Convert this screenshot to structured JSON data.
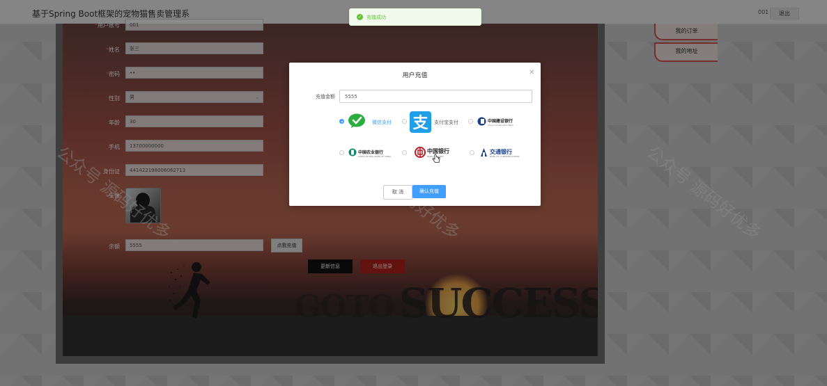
{
  "header": {
    "title": "基于Spring Boot框架的宠物猫售卖管理系",
    "username": "001",
    "logout_label": "退出"
  },
  "toast": {
    "message": "充值成功",
    "icon": "check-circle-icon",
    "color": "#67c23a"
  },
  "form": {
    "fields": [
      {
        "label": "用户账号",
        "value": "001"
      },
      {
        "label": "姓名",
        "value": "张三"
      },
      {
        "label": "密码",
        "value": "••"
      },
      {
        "label": "性别",
        "value": "男"
      },
      {
        "label": "年龄",
        "value": "30"
      },
      {
        "label": "手机",
        "value": "13700000000"
      },
      {
        "label": "身份证",
        "value": "441422198006062713"
      }
    ],
    "avatar_label": "头像",
    "balance_label": "余额",
    "balance_value": "5555",
    "recharge_label": "点我充值",
    "update_label": "更新信息",
    "logout_label": "退出登录"
  },
  "sidebar": {
    "items": [
      {
        "label": "我的订单"
      },
      {
        "label": "我的地址"
      }
    ]
  },
  "banner": {
    "goto": "GOTO",
    "success": "SUCCESS"
  },
  "watermark": {
    "text": "公众号 源码好优多"
  },
  "dialog": {
    "title": "用户充值",
    "amount_label": "充值金额",
    "amount_value": "5555",
    "payment_methods": [
      {
        "label": "微信支付",
        "selected": true,
        "icon": "wechat-icon"
      },
      {
        "label": "支付宝支付",
        "selected": false,
        "icon": "alipay-icon"
      },
      {
        "label": "中国建设银行",
        "sub": "China Construction Bank",
        "selected": false,
        "icon": "ccb-logo"
      },
      {
        "label": "中国农业银行",
        "sub": "AGRICULTURAL BANK OF CHINA",
        "selected": false,
        "icon": "abc-logo"
      },
      {
        "label": "中国银行",
        "sub": "BANK OF CHINA",
        "selected": false,
        "icon": "boc-logo"
      },
      {
        "label": "交通银行",
        "sub": "BANK OF COMMUNICATIONS",
        "selected": false,
        "icon": "bocom-logo"
      }
    ],
    "cancel_label": "取 消",
    "confirm_label": "确认充值",
    "accent": "#409eff"
  }
}
